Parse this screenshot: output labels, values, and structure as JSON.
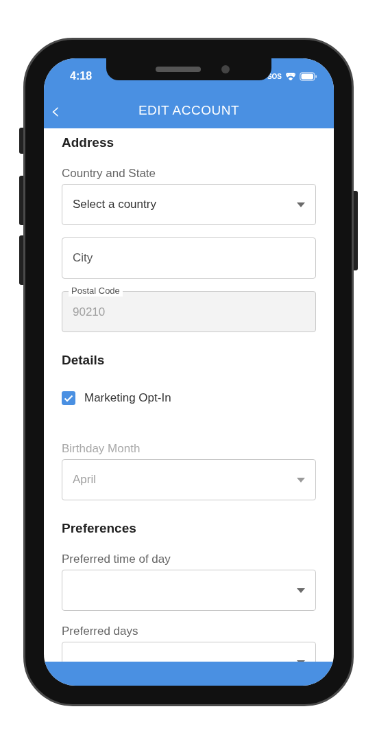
{
  "status_bar": {
    "time": "4:18",
    "carrier": "SOS"
  },
  "header": {
    "back": "‹",
    "title": "EDIT ACCOUNT"
  },
  "sections": [
    {
      "heading": "Address",
      "fields": [
        {
          "kind": "select",
          "label": "Country and State",
          "value": "Select a country",
          "disabled": false
        },
        {
          "kind": "input",
          "placeholder": "City",
          "disabled": false
        },
        {
          "kind": "floating",
          "label": "Postal Code",
          "value": "90210",
          "disabled": true
        }
      ]
    },
    {
      "heading": "Details",
      "fields": [
        {
          "kind": "checkbox",
          "label": "Marketing Opt-In",
          "checked": true
        },
        {
          "kind": "select",
          "label": "Birthday Month",
          "value": "April",
          "disabled": true
        }
      ]
    },
    {
      "heading": "Preferences",
      "fields": [
        {
          "kind": "select",
          "label": "Preferred time of day",
          "disabled": false
        },
        {
          "kind": "select",
          "label": "Preferred days",
          "disabled": false
        }
      ]
    }
  ]
}
